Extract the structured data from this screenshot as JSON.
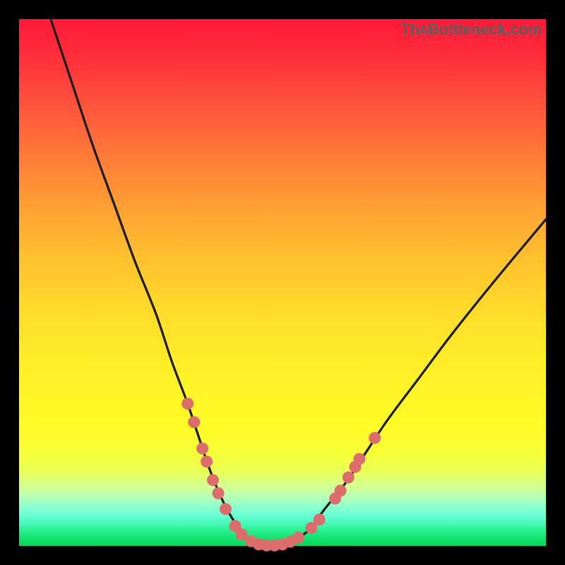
{
  "watermark": "TheBottleneck.com",
  "colors": {
    "frame": "#000000",
    "curve_stroke": "#1a1a1a",
    "dot_fill": "#dd6d6d",
    "dot_stroke": "#c85a5a"
  },
  "chart_data": {
    "type": "line",
    "title": "",
    "xlabel": "",
    "ylabel": "",
    "xlim": [
      0,
      100
    ],
    "ylim": [
      0,
      100
    ],
    "grid": false,
    "legend": false,
    "series": [
      {
        "name": "bottleneck-curve",
        "x": [
          6,
          10,
          14,
          18,
          22,
          26,
          29,
          32,
          34,
          36,
          38,
          40,
          42,
          44,
          46,
          48,
          50,
          52,
          55,
          58,
          62,
          66,
          70,
          76,
          82,
          90,
          100
        ],
        "y": [
          100,
          88,
          76,
          65,
          54,
          44,
          35,
          27,
          21,
          15,
          10,
          6,
          3,
          1,
          0,
          0,
          0,
          1,
          3,
          7,
          12,
          18,
          24,
          32,
          40,
          50,
          62
        ]
      }
    ],
    "scatter_points": {
      "name": "highlight-dots",
      "points": [
        {
          "x": 32.0,
          "y": 27.0
        },
        {
          "x": 33.2,
          "y": 23.5
        },
        {
          "x": 34.8,
          "y": 18.5
        },
        {
          "x": 35.6,
          "y": 16.0
        },
        {
          "x": 36.8,
          "y": 12.5
        },
        {
          "x": 37.8,
          "y": 10.0
        },
        {
          "x": 39.2,
          "y": 7.0
        },
        {
          "x": 41.0,
          "y": 3.8
        },
        {
          "x": 42.2,
          "y": 2.2
        },
        {
          "x": 44.0,
          "y": 0.9
        },
        {
          "x": 45.5,
          "y": 0.3
        },
        {
          "x": 47.0,
          "y": 0.1
        },
        {
          "x": 48.5,
          "y": 0.1
        },
        {
          "x": 50.0,
          "y": 0.3
        },
        {
          "x": 51.5,
          "y": 0.8
        },
        {
          "x": 53.0,
          "y": 1.6
        },
        {
          "x": 55.5,
          "y": 3.4
        },
        {
          "x": 57.0,
          "y": 5.0
        },
        {
          "x": 60.0,
          "y": 9.0
        },
        {
          "x": 61.0,
          "y": 10.5
        },
        {
          "x": 62.5,
          "y": 13.0
        },
        {
          "x": 63.8,
          "y": 15.0
        },
        {
          "x": 64.6,
          "y": 16.5
        },
        {
          "x": 67.5,
          "y": 20.5
        }
      ]
    }
  }
}
